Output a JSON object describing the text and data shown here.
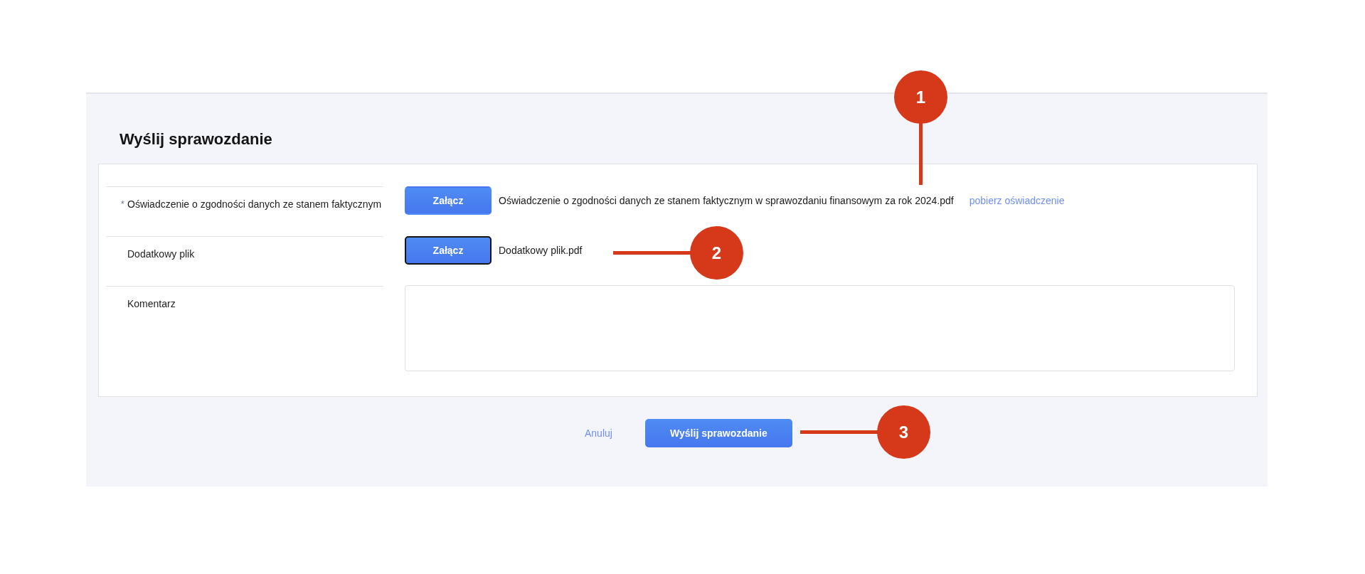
{
  "header": {
    "title": "Wyślij sprawozdanie"
  },
  "form": {
    "rows": [
      {
        "kind": "file",
        "required_mark": "*",
        "label": "Oświadczenie o zgodności danych ze stanem faktycznym",
        "button": {
          "label": "Załącz",
          "focused": false
        },
        "file_name": "Oświadczenie o zgodności danych ze stanem faktycznym w sprawozdaniu finansowym za rok 2024.pdf",
        "link": "pobierz oświadczenie"
      },
      {
        "kind": "file",
        "label": "Dodatkowy plik",
        "button": {
          "label": "Załącz",
          "focused": true
        },
        "file_name": "Dodatkowy plik.pdf"
      },
      {
        "kind": "textarea",
        "label": "Komentarz"
      }
    ]
  },
  "actions": {
    "cancel": "Anuluj",
    "submit": "Wyślij sprawozdanie"
  },
  "callouts": [
    {
      "number": "1"
    },
    {
      "number": "2"
    },
    {
      "number": "3"
    }
  ]
}
